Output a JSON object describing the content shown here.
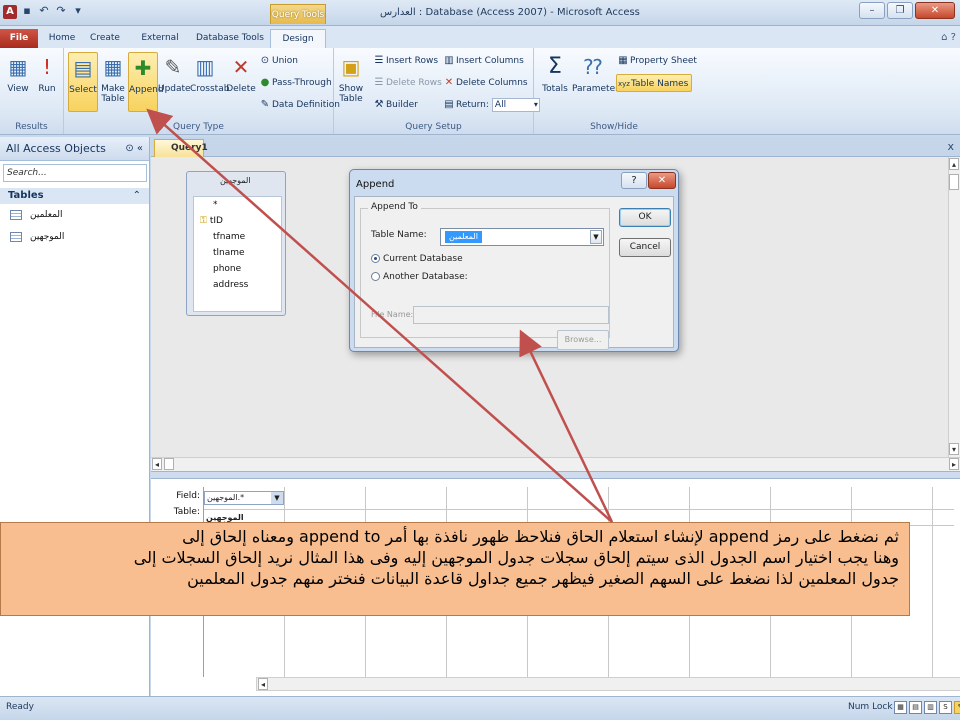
{
  "window": {
    "title": "العدارس : Database (Access 2007) - Microsoft Access",
    "app_icon": "A",
    "context_tab_label": "Query Tools"
  },
  "tabs": [
    {
      "label": "File"
    },
    {
      "label": "Home"
    },
    {
      "label": "Create"
    },
    {
      "label": "External Data"
    },
    {
      "label": "Database Tools"
    },
    {
      "label": "Design"
    }
  ],
  "ribbon": {
    "results": {
      "label": "Results",
      "view": "View",
      "run": "Run"
    },
    "query_type": {
      "label": "Query Type",
      "select": "Select",
      "make_table": "Make Table",
      "append": "Append",
      "update": "Update",
      "crosstab": "Crosstab",
      "delete": "Delete",
      "union": "Union",
      "pass_through": "Pass-Through",
      "data_definition": "Data Definition"
    },
    "query_setup": {
      "label": "Query Setup",
      "show_table": "Show Table",
      "insert_rows": "Insert Rows",
      "delete_rows": "Delete Rows",
      "builder": "Builder",
      "insert_columns": "Insert Columns",
      "delete_columns": "Delete Columns",
      "return_label": "Return:",
      "return_value": "All"
    },
    "show_hide": {
      "label": "Show/Hide",
      "totals": "Totals",
      "parameters": "Parameters",
      "property_sheet": "Property Sheet",
      "table_names": "Table Names"
    }
  },
  "nav": {
    "header": "All Access Objects",
    "search_placeholder": "Search...",
    "group": "Tables",
    "items": [
      {
        "label": "المعلمين"
      },
      {
        "label": "الموجهين"
      }
    ]
  },
  "document": {
    "tab": "Query1",
    "field_list": {
      "title": "الموجهين",
      "fields": [
        "*",
        "tID",
        "tfname",
        "tlname",
        "phone",
        "address"
      ]
    },
    "grid": {
      "row_labels": [
        "Field:",
        "Table:"
      ],
      "field_value": "الموجهين.*",
      "table_value": "الموجهين"
    }
  },
  "dialog": {
    "title": "Append",
    "help": "?",
    "close": "✕",
    "group_label": "Append To",
    "table_name_label": "Table Name:",
    "table_name_value": "المعلمين",
    "current_db": "Current Database",
    "another_db": "Another Database:",
    "file_name_label": "File Name:",
    "browse": "Browse...",
    "ok": "OK",
    "cancel": "Cancel"
  },
  "status": {
    "ready": "Ready",
    "numlock": "Num Lock"
  },
  "callout": {
    "lines": [
      "ثم نضغط على رمز append لإنشاء استعلام الحاق فنلاحظ ظهور نافذة بها أمر append to ومعناه إلحاق إلى",
      "وهنا يجب اختيار اسم الجدول الذى سيتم إلحاق سجلات جدول الموجهين إليه وفى هذا المثال نريد إلحاق السجلات إلى",
      "جدول المعلمين لذا نضغط على السهم الصغير فيظهر جميع جداول قاعدة البيانات فنختر منهم جدول المعلمين"
    ]
  },
  "colors": {
    "callout_bg": "#f9be8f",
    "arrow": "#c0504d",
    "active_button": "#f8d25e",
    "selection": "#3399ff"
  }
}
